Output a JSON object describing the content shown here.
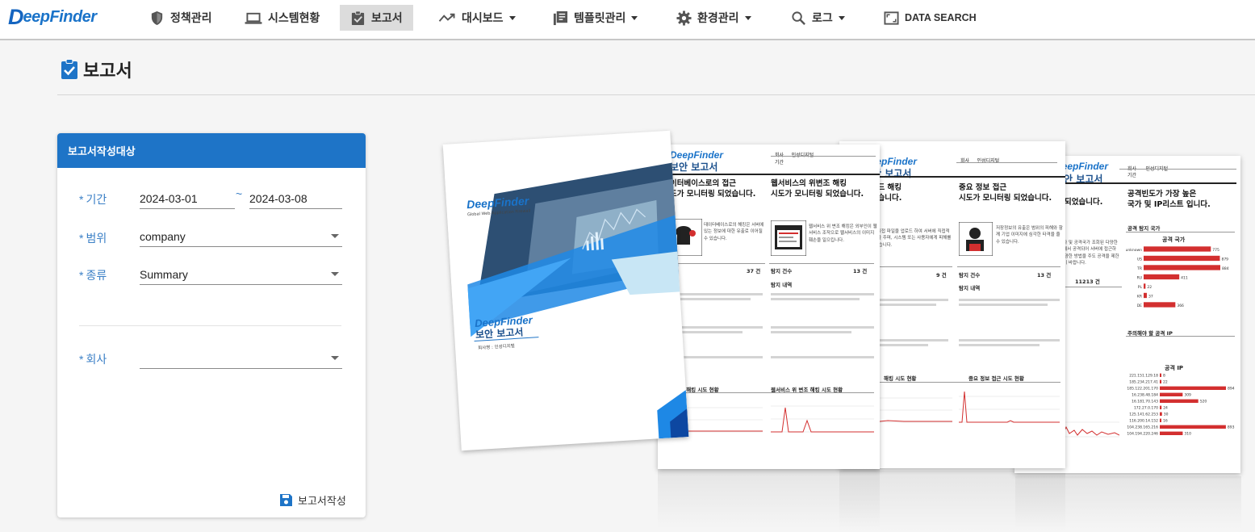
{
  "app": {
    "logo_d": "D",
    "logo_rest": "eepFinder"
  },
  "nav": {
    "items": [
      {
        "label": "정책관리",
        "icon": "shield-icon"
      },
      {
        "label": "시스템현황",
        "icon": "laptop-icon"
      },
      {
        "label": "보고서",
        "icon": "clipboard-check-icon",
        "active": true
      },
      {
        "label": "대시보드",
        "icon": "trend-icon",
        "dropdown": true
      },
      {
        "label": "템플릿관리",
        "icon": "library-icon",
        "dropdown": true
      },
      {
        "label": "환경관리",
        "icon": "gear-icon",
        "dropdown": true
      },
      {
        "label": "로그",
        "icon": "search-icon",
        "dropdown": true
      },
      {
        "label": "DATA SEARCH",
        "icon": "fullscreen-icon"
      }
    ]
  },
  "page": {
    "title": "보고서"
  },
  "form": {
    "header": "보고서작성대상",
    "required_mark": "*",
    "period_label": "기간",
    "date_from": "2024-03-01",
    "date_sep": "~",
    "date_to": "2024-03-08",
    "scope_label": "범위",
    "scope_value": "company",
    "kind_label": "종류",
    "kind_value": "Summary",
    "company_label": "회사",
    "company_value": "",
    "create_button": "보고서작성"
  },
  "preview": {
    "cover": {
      "brand": "DeepFinder",
      "report_title": "보안 보고서",
      "brand_small": "DeepFinder"
    },
    "page1": {
      "brand": "DeepFinder",
      "title": "보안 보고서",
      "left_headline": "이터베이스로의 접근\n도가 모니터링 되었습니다.",
      "right_headline": "웹서비스의 위변조 해킹\n시도가 모니터링 되었습니다.",
      "left_count": "37 건",
      "right_count": "13 건",
      "right_count_label": "탐지 건수",
      "right_detail_label": "탐지 내역",
      "left_chart_title": "소로의 해킹 시도 현황",
      "right_chart_title": "웹서비스 위    변조 해킹 시도 현황"
    },
    "page2": {
      "brand": "DeepFinder",
      "title": "보안 보고서",
      "left_headline": "업로드 해킹\n되었습니다.",
      "right_headline": "중요 정보 접근\n시도가 모니터링 되었습니다.",
      "left_count": "9 건",
      "right_count": "13 건",
      "right_count_label": "탐지 건수",
      "right_detail_label": "탐지 내역",
      "left_chart_title": "해킹 시도 현황",
      "right_chart_title": "중요 정보 접근 시도 현황"
    },
    "page3": {
      "brand": "DeepFinder",
      "title": "보안 보고서",
      "left_headline": "리 되었습니다.",
      "right_headline": "공격빈도가 가장 높은\n국가 및 IP리스트 입니다.",
      "country_section": "공격 탐지 국가",
      "country_chart_title": "공격 국가",
      "country_rows": [
        {
          "label": "unknown",
          "value": 775
        },
        {
          "label": "US",
          "value": 879
        },
        {
          "label": "TR",
          "value": 884
        },
        {
          "label": "RU",
          "value": 411
        },
        {
          "label": "PL",
          "value": 22
        },
        {
          "label": "KR",
          "value": 37
        },
        {
          "label": "DE",
          "value": 366
        }
      ],
      "left_count": "11213 건",
      "ip_section": "주의해야 할 공격 IP",
      "ip_chart_title": "공격 IP",
      "ip_rows": [
        {
          "label": "221.151.129.18",
          "value": 8
        },
        {
          "label": "185.234.217.41",
          "value": 22
        },
        {
          "label": "185.122.201.170",
          "value": 894
        },
        {
          "label": "16.238.48.184",
          "value": 309
        },
        {
          "label": "16.181.70.143",
          "value": 520
        },
        {
          "label": "172.27.0.170",
          "value": 24
        },
        {
          "label": "125.141.62.253",
          "value": 30
        },
        {
          "label": "116.200.14.152",
          "value": 16
        },
        {
          "label": "104.238.165.216",
          "value": 893
        },
        {
          "label": "104.194.220.246",
          "value": 310
        }
      ]
    }
  }
}
